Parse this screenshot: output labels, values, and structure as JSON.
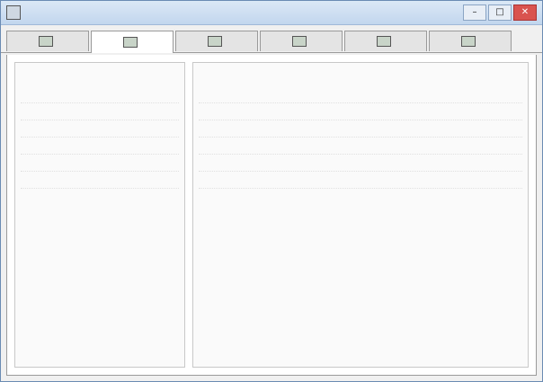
{
  "window": {
    "title": ""
  },
  "tabs": [
    {
      "label": ""
    },
    {
      "label": ""
    },
    {
      "label": ""
    },
    {
      "label": ""
    },
    {
      "label": ""
    },
    {
      "label": ""
    }
  ],
  "left_panel": {
    "title": "",
    "rows": [
      {
        "key": "",
        "value": ""
      },
      {
        "key": "",
        "value": ""
      },
      {
        "key": "",
        "value": ""
      },
      {
        "key": "",
        "value": ""
      },
      {
        "key": "",
        "value": ""
      },
      {
        "key": "",
        "value": ""
      }
    ]
  },
  "right_panel": {
    "title": "",
    "rows": [
      {
        "key": "",
        "value": ""
      },
      {
        "key": "",
        "value": ""
      },
      {
        "key": "",
        "value": ""
      },
      {
        "key": "",
        "value": ""
      },
      {
        "key": "",
        "value": ""
      },
      {
        "key": "",
        "value": ""
      }
    ]
  }
}
